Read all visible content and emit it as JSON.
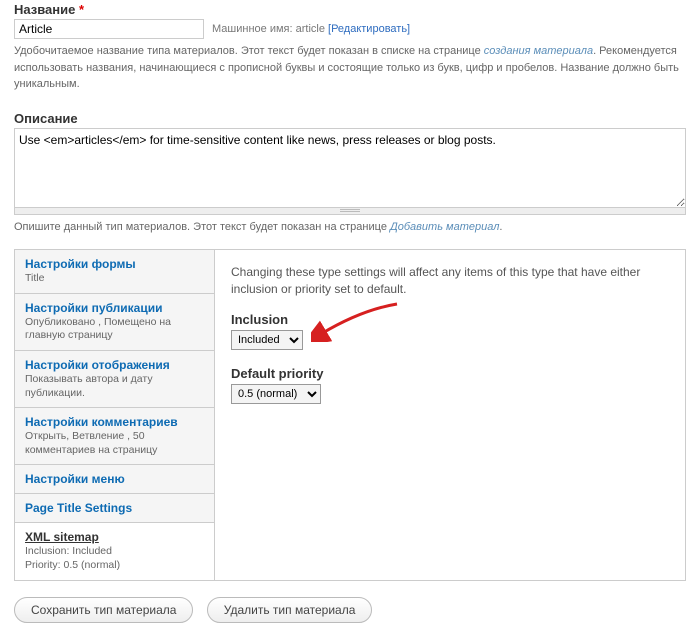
{
  "name": {
    "label": "Название",
    "value": "Article",
    "machine_prefix": "Машинное имя:",
    "machine_value": "article",
    "machine_edit": "[Редактировать]",
    "description_pre": "Удобочитаемое название типа материалов. Этот текст будет показан в списке на странице ",
    "description_em": "создания материала",
    "description_post": ". Рекомендуется использовать названия, начинающиеся с прописной буквы и состоящие только из букв, цифр и пробелов. Название должно быть уникальным."
  },
  "description": {
    "label": "Описание",
    "value": "Use <em>articles</em> for time-sensitive content like news, press releases or blog posts.",
    "help_pre": "Опишите данный тип материалов. Этот текст будет показан на странице ",
    "help_em": "Добавить материал",
    "help_post": "."
  },
  "tabs": [
    {
      "title": "Настройки формы",
      "summary": "Title"
    },
    {
      "title": "Настройки публикации",
      "summary": "Опубликовано , Помещено на главную страницу"
    },
    {
      "title": "Настройки отображения",
      "summary": "Показывать автора и дату публикации."
    },
    {
      "title": "Настройки комментариев",
      "summary": "Открыть, Ветвление , 50 комментариев на страницу"
    },
    {
      "title": "Настройки меню",
      "summary": ""
    },
    {
      "title": "Page Title Settings",
      "summary": ""
    },
    {
      "title": "XML sitemap",
      "summary": "Inclusion: Included\nPriority: 0.5 (normal)"
    }
  ],
  "pane": {
    "info": "Changing these type settings will affect any items of this type that have either inclusion or priority set to default.",
    "inclusion_label": "Inclusion",
    "inclusion_value": "Included",
    "priority_label": "Default priority",
    "priority_value": "0.5 (normal)"
  },
  "actions": {
    "save": "Сохранить тип материала",
    "delete": "Удалить тип материала"
  }
}
